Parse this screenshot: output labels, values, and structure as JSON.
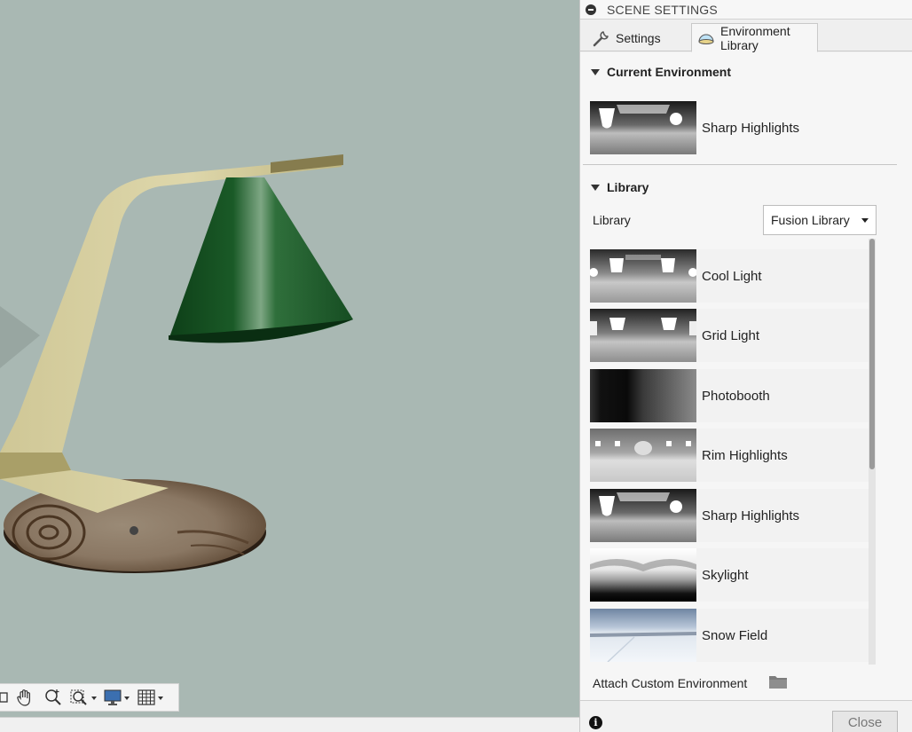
{
  "panel": {
    "title": "SCENE SETTINGS",
    "tabs": [
      {
        "label": "Settings",
        "icon": "wrench-icon"
      },
      {
        "label": "Environment Library",
        "icon": "environment-dome-icon",
        "active": true
      }
    ],
    "current_environment": {
      "heading": "Current Environment",
      "name": "Sharp Highlights"
    },
    "library": {
      "heading": "Library",
      "label": "Library",
      "selected": "Fusion Library",
      "items": [
        {
          "name": "Cool Light"
        },
        {
          "name": "Grid Light"
        },
        {
          "name": "Photobooth"
        },
        {
          "name": "Rim Highlights"
        },
        {
          "name": "Sharp Highlights"
        },
        {
          "name": "Skylight"
        },
        {
          "name": "Snow Field"
        }
      ]
    },
    "attach_label": "Attach Custom Environment",
    "close_label": "Close"
  },
  "viewport": {
    "background_color": "#a9b8b3",
    "toolbar_icons": [
      "orbit-icon",
      "pan-hand-icon",
      "zoom-icon",
      "fit-icon",
      "display-settings-icon",
      "grid-settings-icon"
    ]
  }
}
